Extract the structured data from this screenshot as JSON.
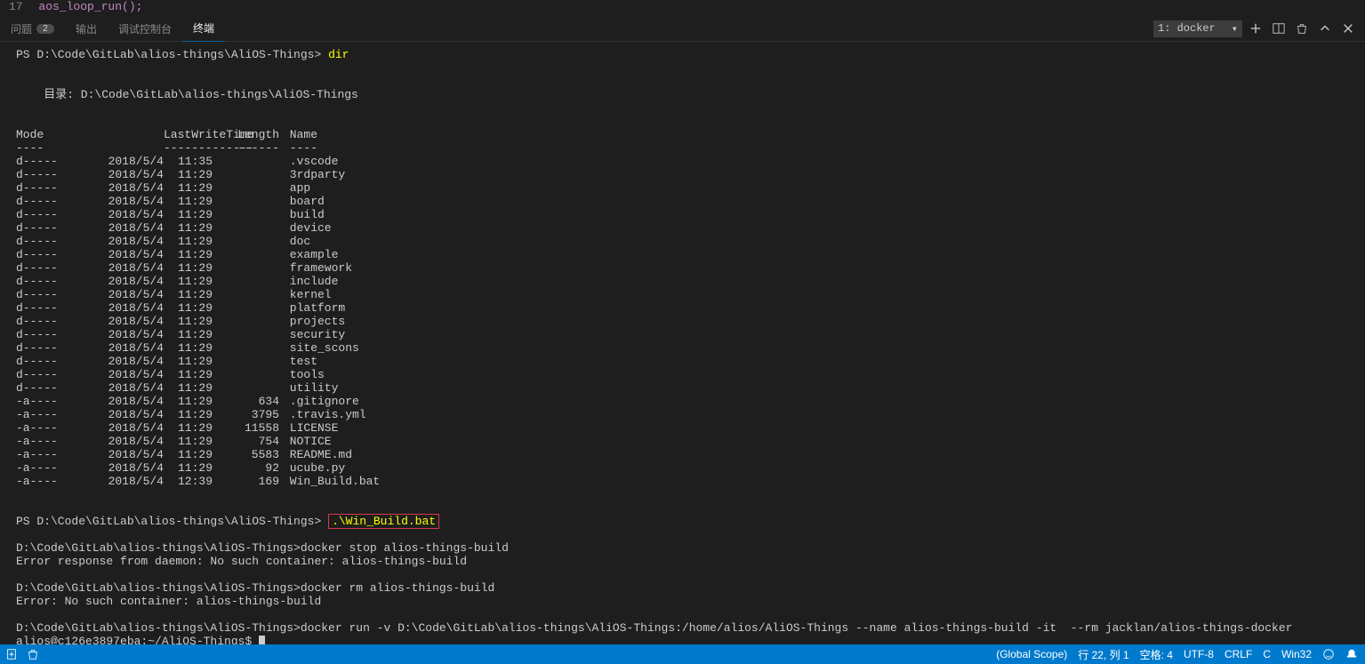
{
  "top_code": {
    "line_number": "17",
    "code": "aos_loop_run();"
  },
  "tabs": {
    "problems": {
      "label": "问题",
      "badge": "2"
    },
    "output": {
      "label": "输出"
    },
    "debug": {
      "label": "调试控制台"
    },
    "terminal": {
      "label": "终端"
    }
  },
  "terminal_dropdown": {
    "label": "1: docker"
  },
  "prompt1": {
    "path": "PS D:\\Code\\GitLab\\alios-things\\AliOS-Things> ",
    "cmd": "dir"
  },
  "dir_header": "    目录: D:\\Code\\GitLab\\alios-things\\AliOS-Things",
  "cols": {
    "mode": "Mode",
    "lwt": "LastWriteTime",
    "len": "Length",
    "name": "Name"
  },
  "sep": {
    "mode": "----",
    "lwt": "-------------",
    "len": "------",
    "name": "----"
  },
  "entries": [
    {
      "mode": "d-----",
      "date": "2018/5/4",
      "time": "11:35",
      "len": "",
      "name": ".vscode"
    },
    {
      "mode": "d-----",
      "date": "2018/5/4",
      "time": "11:29",
      "len": "",
      "name": "3rdparty"
    },
    {
      "mode": "d-----",
      "date": "2018/5/4",
      "time": "11:29",
      "len": "",
      "name": "app"
    },
    {
      "mode": "d-----",
      "date": "2018/5/4",
      "time": "11:29",
      "len": "",
      "name": "board"
    },
    {
      "mode": "d-----",
      "date": "2018/5/4",
      "time": "11:29",
      "len": "",
      "name": "build"
    },
    {
      "mode": "d-----",
      "date": "2018/5/4",
      "time": "11:29",
      "len": "",
      "name": "device"
    },
    {
      "mode": "d-----",
      "date": "2018/5/4",
      "time": "11:29",
      "len": "",
      "name": "doc"
    },
    {
      "mode": "d-----",
      "date": "2018/5/4",
      "time": "11:29",
      "len": "",
      "name": "example"
    },
    {
      "mode": "d-----",
      "date": "2018/5/4",
      "time": "11:29",
      "len": "",
      "name": "framework"
    },
    {
      "mode": "d-----",
      "date": "2018/5/4",
      "time": "11:29",
      "len": "",
      "name": "include"
    },
    {
      "mode": "d-----",
      "date": "2018/5/4",
      "time": "11:29",
      "len": "",
      "name": "kernel"
    },
    {
      "mode": "d-----",
      "date": "2018/5/4",
      "time": "11:29",
      "len": "",
      "name": "platform"
    },
    {
      "mode": "d-----",
      "date": "2018/5/4",
      "time": "11:29",
      "len": "",
      "name": "projects"
    },
    {
      "mode": "d-----",
      "date": "2018/5/4",
      "time": "11:29",
      "len": "",
      "name": "security"
    },
    {
      "mode": "d-----",
      "date": "2018/5/4",
      "time": "11:29",
      "len": "",
      "name": "site_scons"
    },
    {
      "mode": "d-----",
      "date": "2018/5/4",
      "time": "11:29",
      "len": "",
      "name": "test"
    },
    {
      "mode": "d-----",
      "date": "2018/5/4",
      "time": "11:29",
      "len": "",
      "name": "tools"
    },
    {
      "mode": "d-----",
      "date": "2018/5/4",
      "time": "11:29",
      "len": "",
      "name": "utility"
    },
    {
      "mode": "-a----",
      "date": "2018/5/4",
      "time": "11:29",
      "len": "634",
      "name": ".gitignore"
    },
    {
      "mode": "-a----",
      "date": "2018/5/4",
      "time": "11:29",
      "len": "3795",
      "name": ".travis.yml"
    },
    {
      "mode": "-a----",
      "date": "2018/5/4",
      "time": "11:29",
      "len": "11558",
      "name": "LICENSE"
    },
    {
      "mode": "-a----",
      "date": "2018/5/4",
      "time": "11:29",
      "len": "754",
      "name": "NOTICE"
    },
    {
      "mode": "-a----",
      "date": "2018/5/4",
      "time": "11:29",
      "len": "5583",
      "name": "README.md"
    },
    {
      "mode": "-a----",
      "date": "2018/5/4",
      "time": "11:29",
      "len": "92",
      "name": "ucube.py"
    },
    {
      "mode": "-a----",
      "date": "2018/5/4",
      "time": "12:39",
      "len": "169",
      "name": "Win_Build.bat"
    }
  ],
  "prompt2": {
    "path": "PS D:\\Code\\GitLab\\alios-things\\AliOS-Things> ",
    "cmd": ".\\Win_Build.bat"
  },
  "lines": [
    "D:\\Code\\GitLab\\alios-things\\AliOS-Things>docker stop alios-things-build",
    "Error response from daemon: No such container: alios-things-build",
    "",
    "D:\\Code\\GitLab\\alios-things\\AliOS-Things>docker rm alios-things-build",
    "Error: No such container: alios-things-build",
    "",
    "D:\\Code\\GitLab\\alios-things\\AliOS-Things>docker run -v D:\\Code\\GitLab\\alios-things\\AliOS-Things:/home/alios/AliOS-Things --name alios-things-build -it  --rm jacklan/alios-things-docker"
  ],
  "final_prompt": "alios@c126e3897eba:~/AliOS-Things$ ",
  "status": {
    "scope": "(Global Scope)",
    "pos": "行 22, 列 1",
    "spaces": "空格: 4",
    "encoding": "UTF-8",
    "eol": "CRLF",
    "lang": "C",
    "os": "Win32"
  }
}
